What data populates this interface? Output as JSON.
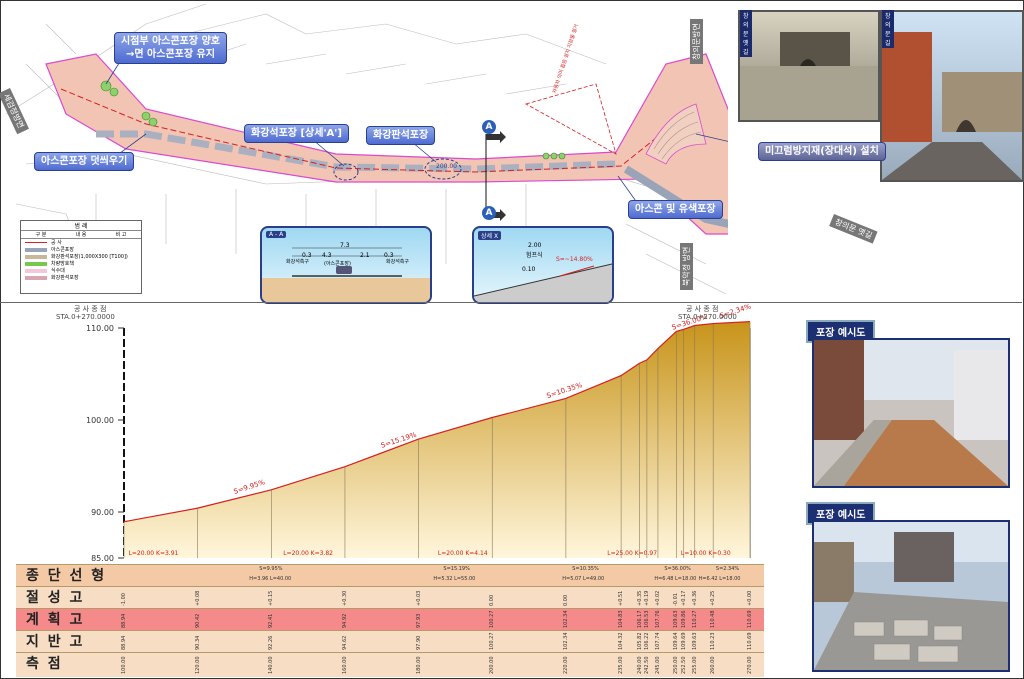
{
  "plan": {
    "callouts": {
      "intersection": "시점부 아스콘포장 양호\n→면 아스콘포장 유지",
      "overlay": "아스콘포장 덧씌우기",
      "granite_detail": "화강석포장 [상세'A']",
      "granite_slab": "화강판석포장",
      "anti_slip": "미끄럼방지재(장대석) 설치",
      "asphalt_color": "아스콘 및 유색포장"
    },
    "road_labels": {
      "left": "세검정방면",
      "top": "창의문방면",
      "right": "창의문 옛길",
      "bottom": "북악정 방면"
    },
    "section_markers": [
      "A",
      "A"
    ],
    "circle_label": "200.00",
    "legend": {
      "title": "범 례",
      "headers": [
        "구 분",
        "내 용",
        "비 고"
      ],
      "items": [
        {
          "label": "공 사",
          "color": "#d42020"
        },
        {
          "label": "아스콘포장",
          "color": "#9aa4b8"
        },
        {
          "label": "화강판석포장(1,000X300 [T100])",
          "color": "#c9b79a"
        },
        {
          "label": "차량방호책",
          "color": "#78c850"
        },
        {
          "label": "식수대",
          "color": "#f2c8d8"
        },
        {
          "label": "화강판석포장",
          "color": "#d8a6b0"
        }
      ]
    },
    "detail_a": {
      "tag": "A - A",
      "dims": [
        "7.3",
        "4.3",
        "0.3",
        "2.1",
        "0.3"
      ],
      "labels": [
        "화강석측구",
        "(아스콘포장)",
        "화강석측구"
      ]
    },
    "detail_x": {
      "tag": "상세 X",
      "dims": [
        "2.00",
        "0.10"
      ],
      "labels": [
        "험프식"
      ],
      "slope": "S=~14.80%"
    },
    "photo_labels": [
      "창의문 옛길",
      "창의문길"
    ],
    "red_note": "자동차 의미 흡음 설치 지장물 철거"
  },
  "side": {
    "title_top": "포장 예시도",
    "title_bottom": "포장 예시도"
  },
  "chart_data": {
    "type": "area",
    "title": "",
    "start_label": "공 사 종 점",
    "start_sta": "STA.0+270.0000",
    "end_label": "공 사 종 점",
    "end_sta": "STA.0+270.0000",
    "y_ticks": [
      "85.00",
      "90.00",
      "100.00",
      "110.00"
    ],
    "ylim": [
      85,
      110
    ],
    "x": [
      100,
      120,
      140,
      160,
      180,
      200,
      220,
      235,
      240,
      242,
      245,
      250,
      252,
      255,
      260,
      270
    ],
    "planned_height": [
      88.94,
      90.42,
      92.41,
      94.92,
      97.93,
      100.27,
      102.34,
      104.83,
      106.17,
      106.53,
      107.76,
      109.63,
      109.86,
      110.27,
      110.48,
      110.69
    ],
    "slopes": [
      "S=9.95%",
      "S=15.19%",
      "S=10.35%",
      "S=36.00%",
      "S=2.34%"
    ],
    "segment_labels": [
      "L=20.00 K=3.91",
      "L=20.00 K=3.82",
      "L=20.00 K=4.14",
      "L=25.00 K=0.97",
      "L=10.00 K=0.30"
    ]
  },
  "table": {
    "rows": [
      {
        "label": "종 단 선 형",
        "color": "#f4c9a6"
      },
      {
        "label": "절 성 고",
        "color": "#f6ddc3"
      },
      {
        "label": "계 획 고",
        "color": "#f48a8a"
      },
      {
        "label": "지 반 고",
        "color": "#f6ddc3"
      },
      {
        "label": "측 점",
        "color": "#f6ddc3"
      }
    ],
    "vc_labels": [
      "H=3.96 L=40.00",
      "H=5.32 L=55.00",
      "H=5.07 L=49.00",
      "H=6.48 L=18.00",
      "H=6.42 L=18.00"
    ],
    "stations": [
      "100.00",
      "120.00",
      "140.00",
      "160.00",
      "180.00",
      "200.00",
      "220.00",
      "235.00",
      "240.00",
      "242.50",
      "245.00",
      "250.00",
      "252.50",
      "255.00",
      "260.00",
      "270.00"
    ],
    "cut_fill": [
      "-1.00",
      "+0.08",
      "+0.15",
      "+0.30",
      "+0.03",
      "0.00",
      "0.00",
      "+0.51",
      "+0.35",
      "+0.19",
      "+0.02",
      "-0.01",
      "+0.17",
      "+0.36",
      "+0.25",
      "+0.00"
    ],
    "plan": [
      "88.94",
      "90.42",
      "92.41",
      "94.92",
      "97.93",
      "100.27",
      "102.34",
      "104.83",
      "106.17",
      "106.53",
      "107.76",
      "109.63",
      "109.86",
      "110.27",
      "110.48",
      "110.69"
    ],
    "ground": [
      "88.94",
      "90.34",
      "92.26",
      "94.62",
      "97.90",
      "100.27",
      "102.34",
      "104.32",
      "105.82",
      "106.22",
      "107.74",
      "109.64",
      "109.69",
      "109.63",
      "110.23",
      "110.69"
    ]
  }
}
